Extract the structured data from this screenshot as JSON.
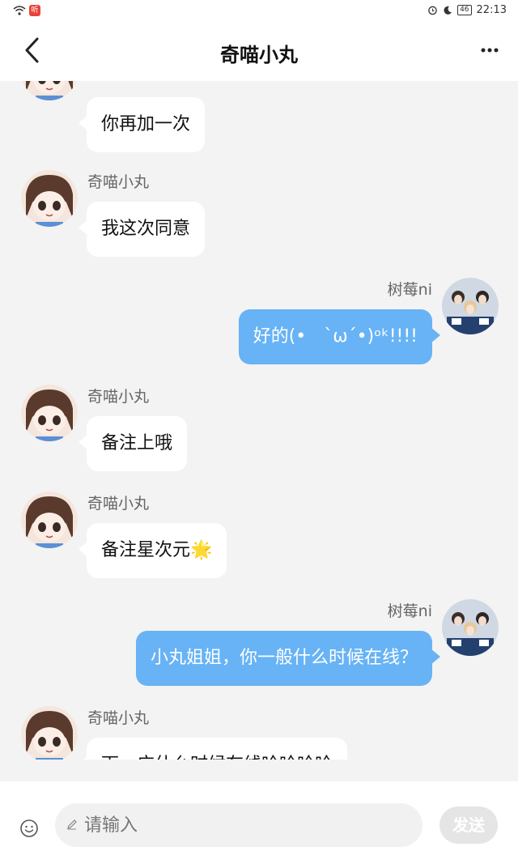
{
  "status_bar": {
    "left_badge": "听",
    "battery": "46",
    "time": "22:13"
  },
  "header": {
    "title": "奇喵小丸"
  },
  "messages": [
    {
      "side": "left",
      "sender": "",
      "text": "你再加一次"
    },
    {
      "side": "left",
      "sender": "奇喵小丸",
      "text": "我这次同意"
    },
    {
      "side": "right",
      "sender": "树莓ni",
      "text": "好的(•　`ω´•)ᵒᵏ!!!!"
    },
    {
      "side": "left",
      "sender": "奇喵小丸",
      "text": "备注上哦"
    },
    {
      "side": "left",
      "sender": "奇喵小丸",
      "text": "备注星次元🌟"
    },
    {
      "side": "right",
      "sender": "树莓ni",
      "text": "小丸姐姐，你一般什么时候在线？"
    },
    {
      "side": "left",
      "sender": "奇喵小丸",
      "text": "下一广什么时候在线哈哈哈哈"
    }
  ],
  "input": {
    "placeholder": "请输入",
    "send_label": "发送"
  },
  "colors": {
    "outgoing_bubble": "#67b3f5",
    "incoming_bubble": "#ffffff",
    "background": "#f3f3f3"
  }
}
